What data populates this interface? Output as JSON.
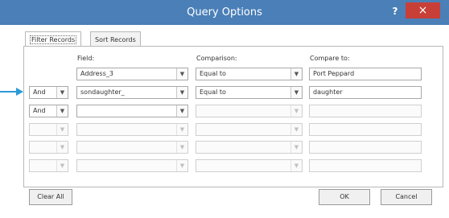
{
  "window": {
    "title": "Query Options",
    "help": "?",
    "close": "×"
  },
  "tabs": [
    {
      "label": "Filter Records",
      "active": true
    },
    {
      "label": "Sort Records",
      "active": false
    }
  ],
  "columns": {
    "field": "Field:",
    "comparison": "Comparison:",
    "compare_to": "Compare to:"
  },
  "rows": [
    {
      "conj": "",
      "field": "Address_3",
      "comparison": "Equal to",
      "compare_to": "Port Peppard"
    },
    {
      "conj": "And",
      "field": "sondaughter_",
      "comparison": "Equal to",
      "compare_to": "daughter"
    },
    {
      "conj": "And",
      "field": "",
      "comparison": "",
      "compare_to": ""
    },
    {
      "conj": "",
      "field": "",
      "comparison": "",
      "compare_to": ""
    },
    {
      "conj": "",
      "field": "",
      "comparison": "",
      "compare_to": ""
    },
    {
      "conj": "",
      "field": "",
      "comparison": "",
      "compare_to": ""
    }
  ],
  "buttons": {
    "clear_all": "Clear All",
    "ok": "OK",
    "cancel": "Cancel"
  },
  "colors": {
    "titlebar": "#4a7fb7",
    "close": "#c83f38",
    "pointer": "#2a9ad8"
  }
}
